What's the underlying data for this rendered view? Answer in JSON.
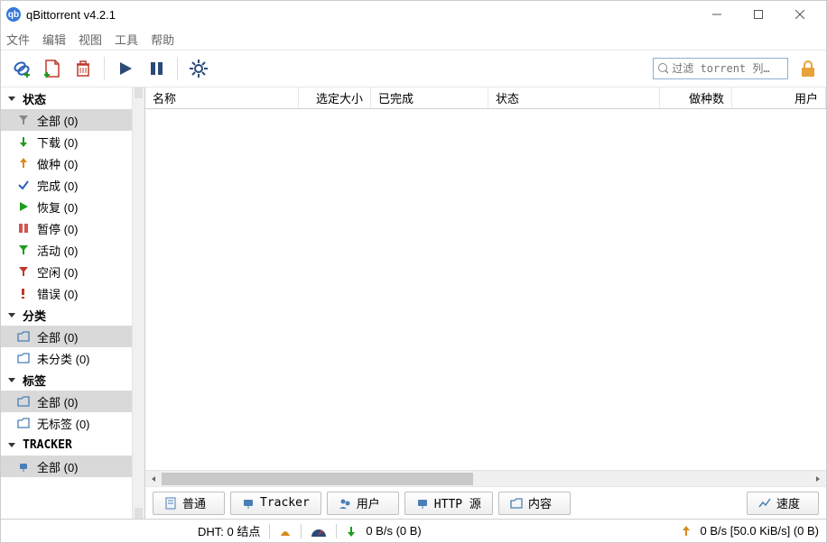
{
  "window": {
    "title": "qBittorrent v4.2.1",
    "logo_text": "qb"
  },
  "menu": {
    "file": "文件",
    "edit": "编辑",
    "view": "视图",
    "tools": "工具",
    "help": "帮助"
  },
  "toolbar": {
    "filter_placeholder": "过滤 torrent 列…"
  },
  "sidebar": {
    "status": {
      "header": "状态",
      "all": "全部 (0)",
      "downloading": "下载 (0)",
      "seeding": "做种 (0)",
      "completed": "完成 (0)",
      "resumed": "恢复 (0)",
      "paused": "暂停 (0)",
      "active": "活动 (0)",
      "inactive": "空闲 (0)",
      "errored": "错误 (0)"
    },
    "categories": {
      "header": "分类",
      "all": "全部 (0)",
      "uncategorized": "未分类 (0)"
    },
    "tags": {
      "header": "标签",
      "all": "全部 (0)",
      "untagged": "无标签 (0)"
    },
    "tracker": {
      "header": "TRACKER",
      "all": "全部 (0)"
    }
  },
  "columns": {
    "name": "名称",
    "size": "选定大小",
    "done": "已完成",
    "status": "状态",
    "seeds": "做种数",
    "peers": "用户"
  },
  "tabs": {
    "general": "普通",
    "tracker": "Tracker",
    "peers": "用户",
    "http": "HTTP 源",
    "content": "内容",
    "speed": "速度"
  },
  "status": {
    "dht": "DHT: 0 结点",
    "down": "0 B/s (0 B)",
    "up": "0 B/s [50.0 KiB/s] (0 B)"
  }
}
